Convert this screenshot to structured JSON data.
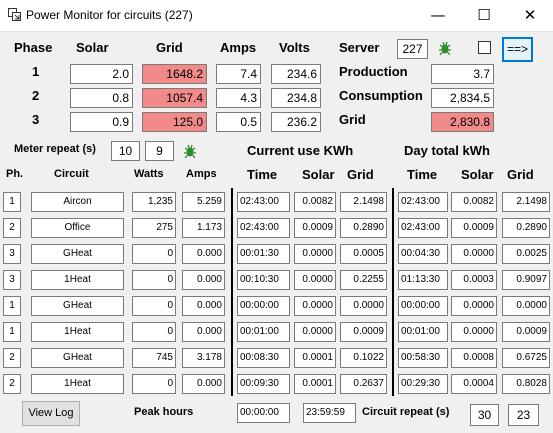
{
  "window": {
    "title": "Power Monitor for circuits (227)",
    "minimize": "—",
    "maximize": "☐",
    "close": "✕"
  },
  "headers": {
    "phase": "Phase",
    "solar": "Solar",
    "grid": "Grid",
    "amps": "Amps",
    "volts": "Volts"
  },
  "phases": [
    {
      "n": "1",
      "solar": "2.0",
      "grid": "1648.2",
      "amps": "7.4",
      "volts": "234.6"
    },
    {
      "n": "2",
      "solar": "0.8",
      "grid": "1057.4",
      "amps": "4.3",
      "volts": "234.8"
    },
    {
      "n": "3",
      "solar": "0.9",
      "grid": "125.0",
      "amps": "0.5",
      "volts": "236.2"
    }
  ],
  "server": {
    "label": "Server",
    "value": "227",
    "next_button": "==>"
  },
  "totals": {
    "production_label": "Production",
    "production": "3.7",
    "consumption_label": "Consumption",
    "consumption": "2,834.5",
    "grid_label": "Grid",
    "grid": "2,830.8"
  },
  "meter_repeat": {
    "label": "Meter repeat (s)",
    "value1": "10",
    "value2": "9"
  },
  "sections": {
    "current": "Current  use KWh",
    "day_total": "Day total kWh"
  },
  "col_headers": {
    "ph": "Ph.",
    "circuit": "Circuit",
    "watts": "Watts",
    "amps": "Amps",
    "time": "Time",
    "solar": "Solar",
    "grid": "Grid",
    "time2": "Time",
    "solar2": "Solar",
    "grid2": "Grid"
  },
  "circuits": [
    {
      "ph": "1",
      "name": "Aircon",
      "watts": "1,235",
      "amps": "5.259",
      "c_time": "02:43:00",
      "c_solar": "0.0082",
      "c_grid": "2.1498",
      "d_time": "02:43:00",
      "d_solar": "0.0082",
      "d_grid": "2.1498"
    },
    {
      "ph": "2",
      "name": "Office",
      "watts": "275",
      "amps": "1.173",
      "c_time": "02:43:00",
      "c_solar": "0.0009",
      "c_grid": "0.2890",
      "d_time": "02:43:00",
      "d_solar": "0.0009",
      "d_grid": "0.2890"
    },
    {
      "ph": "3",
      "name": "GHeat",
      "watts": "0",
      "amps": "0.000",
      "c_time": "00:01:30",
      "c_solar": "0.0000",
      "c_grid": "0.0005",
      "d_time": "00:04:30",
      "d_solar": "0.0000",
      "d_grid": "0.0025"
    },
    {
      "ph": "3",
      "name": "1Heat",
      "watts": "0",
      "amps": "0.000",
      "c_time": "00:10:30",
      "c_solar": "0.0000",
      "c_grid": "0.2255",
      "d_time": "01:13:30",
      "d_solar": "0.0003",
      "d_grid": "0.9097"
    },
    {
      "ph": "1",
      "name": "GHeat",
      "watts": "0",
      "amps": "0.000",
      "c_time": "00:00:00",
      "c_solar": "0.0000",
      "c_grid": "0.0000",
      "d_time": "00:00:00",
      "d_solar": "0.0000",
      "d_grid": "0.0000"
    },
    {
      "ph": "1",
      "name": "1Heat",
      "watts": "0",
      "amps": "0.000",
      "c_time": "00:01:00",
      "c_solar": "0.0000",
      "c_grid": "0.0009",
      "d_time": "00:01:00",
      "d_solar": "0.0000",
      "d_grid": "0.0009"
    },
    {
      "ph": "2",
      "name": "GHeat",
      "watts": "745",
      "amps": "3.178",
      "c_time": "00:08:30",
      "c_solar": "0.0001",
      "c_grid": "0.1022",
      "d_time": "00:58:30",
      "d_solar": "0.0008",
      "d_grid": "0.6725"
    },
    {
      "ph": "2",
      "name": "1Heat",
      "watts": "0",
      "amps": "0.000",
      "c_time": "00:09:30",
      "c_solar": "0.0001",
      "c_grid": "0.2637",
      "d_time": "00:29:30",
      "d_solar": "0.0004",
      "d_grid": "0.8028"
    }
  ],
  "footer": {
    "view_log": "View Log",
    "peak_label": "Peak hours",
    "peak_start": "00:00:00",
    "peak_end": "23:59:59",
    "circuit_repeat_label": "Circuit repeat (s)",
    "repeat1": "30",
    "repeat2": "23"
  },
  "colors": {
    "grid_highlight": "#f28a8a",
    "activity_icon": "#2e8b2e"
  }
}
